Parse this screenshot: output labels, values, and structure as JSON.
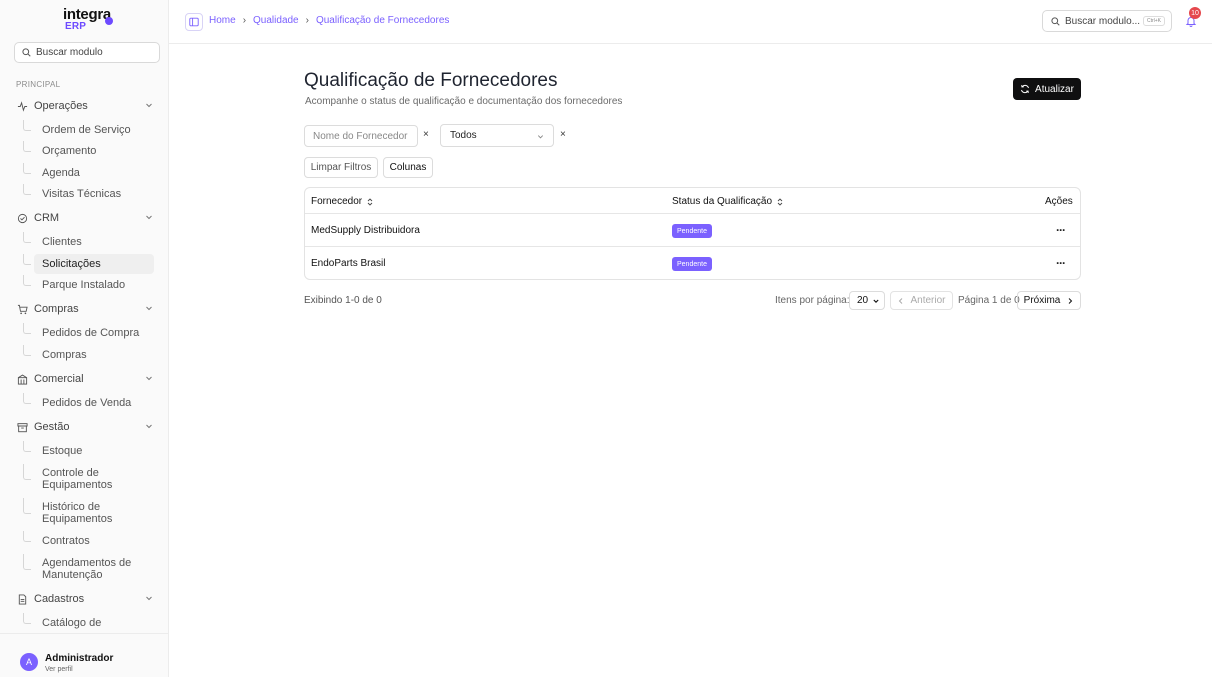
{
  "brand": {
    "name": "integra",
    "sub": "ERP",
    "accent": "#7b61ff"
  },
  "sidebar": {
    "search_placeholder": "Buscar modulo",
    "section_label": "PRINCIPAL",
    "groups": [
      {
        "label": "Operações",
        "icon": "activity-icon",
        "items": [
          "Ordem de Serviço",
          "Orçamento",
          "Agenda",
          "Visitas Técnicas"
        ]
      },
      {
        "label": "CRM",
        "icon": "check-circle-icon",
        "items": [
          "Clientes",
          "Solicitações",
          "Parque Instalado"
        ]
      },
      {
        "label": "Compras",
        "icon": "cart-icon",
        "items": [
          "Pedidos de Compra",
          "Compras"
        ]
      },
      {
        "label": "Comercial",
        "icon": "building-icon",
        "items": [
          "Pedidos de Venda"
        ]
      },
      {
        "label": "Gestão",
        "icon": "archive-icon",
        "items": [
          "Estoque",
          "Controle de Equipamentos",
          "Histórico de Equipamentos",
          "Contratos",
          "Agendamentos de Manutenção"
        ]
      },
      {
        "label": "Cadastros",
        "icon": "file-icon",
        "items": [
          "Catálogo de"
        ]
      }
    ],
    "active_item": "Solicitações",
    "user": {
      "initial": "A",
      "name": "Administrador",
      "link": "Ver perfil"
    }
  },
  "topbar": {
    "breadcrumbs": [
      "Home",
      "Qualidade",
      "Qualificação de Fornecedores"
    ],
    "search_placeholder": "Buscar modulo...",
    "shortcut": "Ctrl+K",
    "notifications": "10"
  },
  "page": {
    "title": "Qualificação de Fornecedores",
    "subtitle": "Acompanhe o status de qualificação e documentação dos fornecedores",
    "refresh_label": "Atualizar"
  },
  "filters": {
    "name_placeholder": "Nome do Fornecedor",
    "status_value": "Todos",
    "clear_glyph": "×",
    "clear_label": "Limpar Filtros",
    "columns_label": "Colunas"
  },
  "table": {
    "columns": [
      "Fornecedor",
      "Status da Qualificação",
      "Ações"
    ],
    "rows": [
      {
        "supplier": "MedSupply Distribuidora",
        "status": "Pendente"
      },
      {
        "supplier": "EndoParts Brasil",
        "status": "Pendente"
      }
    ],
    "actions_glyph": "···"
  },
  "pagination": {
    "showing": "Exibindo 1-0 de 0",
    "per_page_label": "Itens por página:",
    "per_page_value": "20",
    "prev_label": "Anterior",
    "page_info": "Página 1 de 0",
    "next_label": "Próxima"
  }
}
